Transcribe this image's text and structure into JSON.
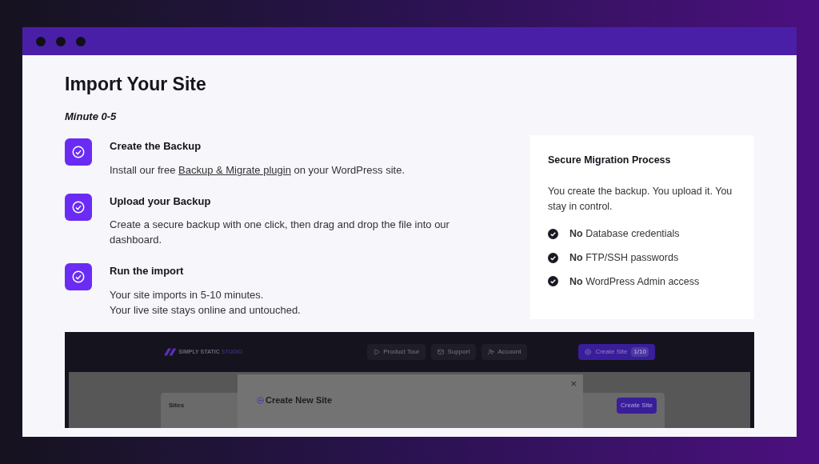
{
  "page": {
    "title": "Import Your Site",
    "subtitle": "Minute 0-5"
  },
  "steps": [
    {
      "title": "Create the Backup",
      "lines": [
        {
          "before": "Install our free ",
          "link": "Backup & Migrate plugin",
          "after": " on your WordPress site."
        }
      ]
    },
    {
      "title": "Upload your Backup",
      "lines": [
        {
          "before": "Create a secure backup with one click, then drag and drop the file into our dashboard."
        }
      ]
    },
    {
      "title": "Run the import",
      "lines": [
        {
          "before": "Your site imports in 5-10 minutes."
        },
        {
          "before": "Your live site stays online and untouched."
        }
      ]
    }
  ],
  "card": {
    "title": "Secure Migration Process",
    "body": "You create the backup. You upload it. You stay in control.",
    "items": [
      "**No** Database credentials",
      "**No** FTP/SSH passwords",
      "**No** WordPress Admin access"
    ]
  },
  "preview": {
    "logo": "SIMPLY STATIC",
    "logo_accent": "STUDIO",
    "nav": [
      "Product Tour",
      "Support",
      "Account"
    ],
    "create_button": "Create Site",
    "create_count": "1/10",
    "modal_title": "Create New Site",
    "modal_close": "×",
    "sidebar_label": "Sites",
    "side_button": "Create Site"
  }
}
